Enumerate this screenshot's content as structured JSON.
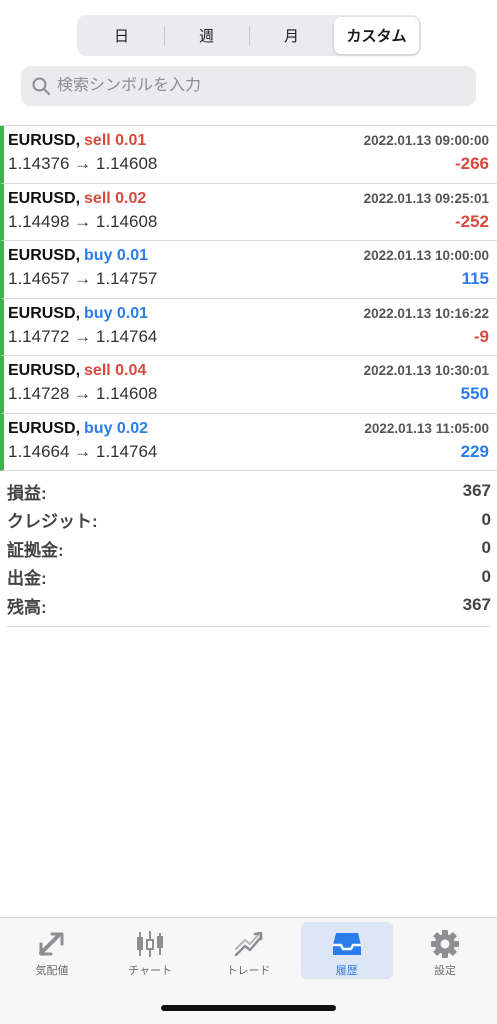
{
  "period_tabs": [
    {
      "label": "日",
      "active": false
    },
    {
      "label": "週",
      "active": false
    },
    {
      "label": "月",
      "active": false
    },
    {
      "label": "カスタム",
      "active": true
    }
  ],
  "search": {
    "placeholder": "検索シンボルを入力",
    "icon": "search-icon"
  },
  "trades": [
    {
      "symbol": "EURUSD,",
      "type": "sell 0.01",
      "side": "sell",
      "time": "2022.01.13 09:00:00",
      "prices": "1.14376 → 1.14608",
      "profit": "-266"
    },
    {
      "symbol": "EURUSD,",
      "type": "sell 0.02",
      "side": "sell",
      "time": "2022.01.13 09:25:01",
      "prices": "1.14498 → 1.14608",
      "profit": "-252"
    },
    {
      "symbol": "EURUSD,",
      "type": "buy 0.01",
      "side": "buy",
      "time": "2022.01.13 10:00:00",
      "prices": "1.14657 → 1.14757",
      "profit": "115"
    },
    {
      "symbol": "EURUSD,",
      "type": "buy 0.01",
      "side": "buy",
      "time": "2022.01.13 10:16:22",
      "prices": "1.14772 → 1.14764",
      "profit": "-9"
    },
    {
      "symbol": "EURUSD,",
      "type": "sell 0.04",
      "side": "sell",
      "time": "2022.01.13 10:30:01",
      "prices": "1.14728 → 1.14608",
      "profit": "550"
    },
    {
      "symbol": "EURUSD,",
      "type": "buy 0.02",
      "side": "buy",
      "time": "2022.01.13 11:05:00",
      "prices": "1.14664 → 1.14764",
      "profit": "229"
    }
  ],
  "summary": [
    {
      "label": "損益:",
      "value": "367"
    },
    {
      "label": "クレジット:",
      "value": "0"
    },
    {
      "label": "証拠金:",
      "value": "0"
    },
    {
      "label": "出金:",
      "value": "0"
    },
    {
      "label": "残高:",
      "value": "367"
    }
  ],
  "tabbar": [
    {
      "label": "気配値",
      "icon": "quotes-icon",
      "active": false
    },
    {
      "label": "チャート",
      "icon": "candlestick-chart-icon",
      "active": false
    },
    {
      "label": "トレード",
      "icon": "trade-icon",
      "active": false
    },
    {
      "label": "履歴",
      "icon": "history-inbox-icon",
      "active": true
    },
    {
      "label": "設定",
      "icon": "gear-icon",
      "active": false
    }
  ],
  "colors": {
    "sell": "#d94a3e",
    "buy": "#2b7de9",
    "row_accent": "#3eb34a",
    "active_tab_bg": "#dce6f7"
  }
}
